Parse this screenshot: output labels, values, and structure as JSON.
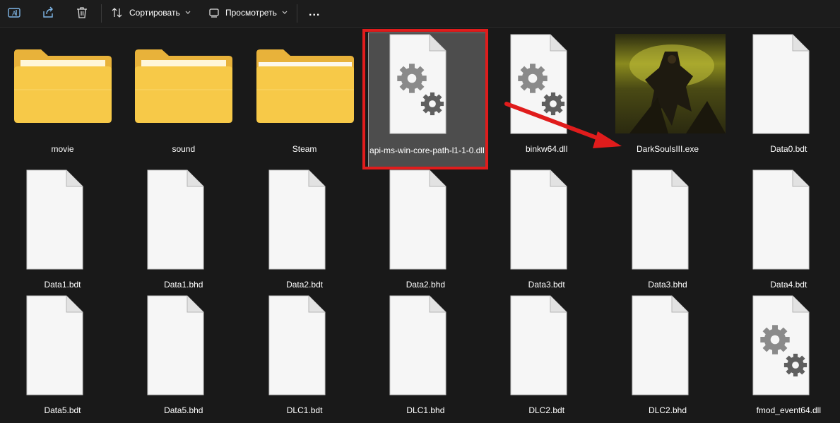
{
  "toolbar": {
    "sort_label": "Сортировать",
    "view_label": "Просмотреть",
    "more_label": "..."
  },
  "files": [
    {
      "name": "movie",
      "type": "folder-doc"
    },
    {
      "name": "sound",
      "type": "folder-doc"
    },
    {
      "name": "Steam",
      "type": "folder"
    },
    {
      "name": "api-ms-win-core-path-l1-1-0.dll",
      "type": "dll",
      "selected": true
    },
    {
      "name": "binkw64.dll",
      "type": "dll"
    },
    {
      "name": "DarkSoulsIII.exe",
      "type": "exe"
    },
    {
      "name": "Data0.bdt",
      "type": "file"
    },
    {
      "name": "Data1.bdt",
      "type": "file"
    },
    {
      "name": "Data1.bhd",
      "type": "file"
    },
    {
      "name": "Data2.bdt",
      "type": "file"
    },
    {
      "name": "Data2.bhd",
      "type": "file"
    },
    {
      "name": "Data3.bdt",
      "type": "file"
    },
    {
      "name": "Data3.bhd",
      "type": "file"
    },
    {
      "name": "Data4.bdt",
      "type": "file"
    },
    {
      "name": "Data5.bdt",
      "type": "file"
    },
    {
      "name": "Data5.bhd",
      "type": "file"
    },
    {
      "name": "DLC1.bdt",
      "type": "file"
    },
    {
      "name": "DLC1.bhd",
      "type": "file"
    },
    {
      "name": "DLC2.bdt",
      "type": "file"
    },
    {
      "name": "DLC2.bhd",
      "type": "file"
    },
    {
      "name": "fmod_event64.dll",
      "type": "dll"
    }
  ],
  "colors": {
    "background": "#191919",
    "selection": "#4d4d4d",
    "highlight": "#e01c1c",
    "folder": "#f7c948",
    "gear": "#7d7d7d"
  }
}
